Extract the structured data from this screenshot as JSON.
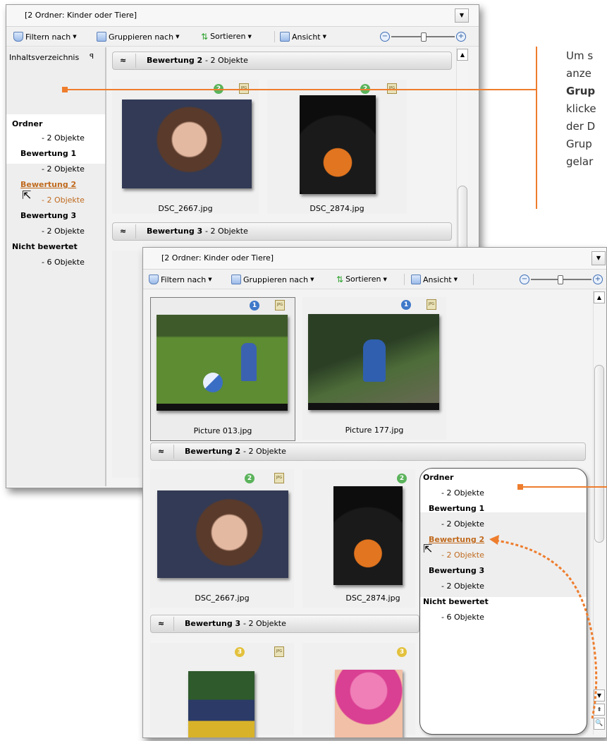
{
  "window_back": {
    "title": "[2 Ordner: Kinder oder Tiere]",
    "toolbar": {
      "filter": "Filtern nach",
      "group": "Gruppieren nach",
      "sort": "Sortieren",
      "view": "Ansicht"
    },
    "side_title": "Inhaltsverzeichnis",
    "side_pin": "ꟼ",
    "nav": [
      {
        "label": "Ordner",
        "count": "- 2 Objekte"
      },
      {
        "label": "Bewertung 1",
        "count": "- 2 Objekte"
      },
      {
        "label": "Bewertung 2",
        "count": "- 2 Objekte"
      },
      {
        "label": "Bewertung 3",
        "count": "- 2 Objekte"
      },
      {
        "label": "Nicht bewertet",
        "count": "- 6 Objekte"
      }
    ],
    "groups": [
      {
        "title": "Bewertung 2",
        "count": "- 2 Objekte"
      },
      {
        "title": "Bewertung 3",
        "count": "- 2 Objekte"
      }
    ],
    "files": [
      {
        "name": "DSC_2667.jpg",
        "rating": "2"
      },
      {
        "name": "DSC_2874.jpg",
        "rating": "2"
      }
    ]
  },
  "window_front": {
    "title": "[2 Ordner: Kinder oder Tiere]",
    "toolbar": {
      "filter": "Filtern nach",
      "group": "Gruppieren nach",
      "sort": "Sortieren",
      "view": "Ansicht"
    },
    "files_top": [
      {
        "name": "Picture 013.jpg",
        "rating": "1"
      },
      {
        "name": "Picture 177.jpg",
        "rating": "1"
      }
    ],
    "groups": [
      {
        "title": "Bewertung 2",
        "count": "- 2 Objekte"
      },
      {
        "title": "Bewertung 3",
        "count": "- 2 Objekte"
      }
    ],
    "files_mid": [
      {
        "name": "DSC_2667.jpg",
        "rating": "2"
      },
      {
        "name": "DSC_2874.jpg",
        "rating": "2"
      }
    ],
    "files_bottom": [
      {
        "rating": "3"
      },
      {
        "rating": "3"
      }
    ],
    "nav": [
      {
        "label": "Ordner",
        "count": "- 2 Objekte"
      },
      {
        "label": "Bewertung 1",
        "count": "- 2 Objekte"
      },
      {
        "label": "Bewertung 2",
        "count": "- 2 Objekte"
      },
      {
        "label": "Bewertung 3",
        "count": "- 2 Objekte"
      },
      {
        "label": "Nicht bewertet",
        "count": "- 6 Objekte"
      }
    ]
  },
  "callout": {
    "line1": "Um s",
    "line2": "anze",
    "line3": "Grup",
    "line4": "klicke",
    "line5": "der D",
    "line6": "Grup",
    "line7": "gelar"
  },
  "icons": {
    "jpg": "JPG",
    "collapse": "≈",
    "caret": "▼",
    "minus": "−",
    "plus": "+",
    "up": "▲",
    "down": "▼",
    "top": "⇞",
    "search": "🔍"
  },
  "colors": {
    "accent": "#ee7d2d",
    "active_link": "#c06a1e",
    "rating_green": "#5bb35b",
    "rating_blue": "#3f79c9",
    "rating_yellow": "#e3c13d"
  }
}
